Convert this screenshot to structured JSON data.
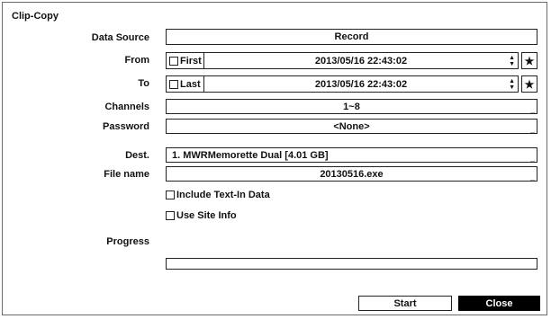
{
  "dialog": {
    "title": "Clip-Copy"
  },
  "labels": {
    "data_source": "Data Source",
    "from": "From",
    "to": "To",
    "channels": "Channels",
    "password": "Password",
    "dest": "Dest.",
    "file_name": "File name",
    "progress": "Progress"
  },
  "fields": {
    "data_source": "Record",
    "from_checkbox_label": "First",
    "from_datetime": "2013/05/16  22:43:02",
    "to_checkbox_label": "Last",
    "to_datetime": "2013/05/16  22:43:02",
    "channels": "1~8",
    "password": "<None>",
    "dest": "1. MWRMemorette Dual [4.01 GB]",
    "file_name": "20130516.exe",
    "dropdown_marker": "_"
  },
  "options": {
    "include_text_in": "Include Text-In Data",
    "use_site_info": "Use Site Info"
  },
  "progress": {
    "value": 0
  },
  "buttons": {
    "start": "Start",
    "close": "Close"
  },
  "icons": {
    "star": "★",
    "spin": "▲▼"
  }
}
